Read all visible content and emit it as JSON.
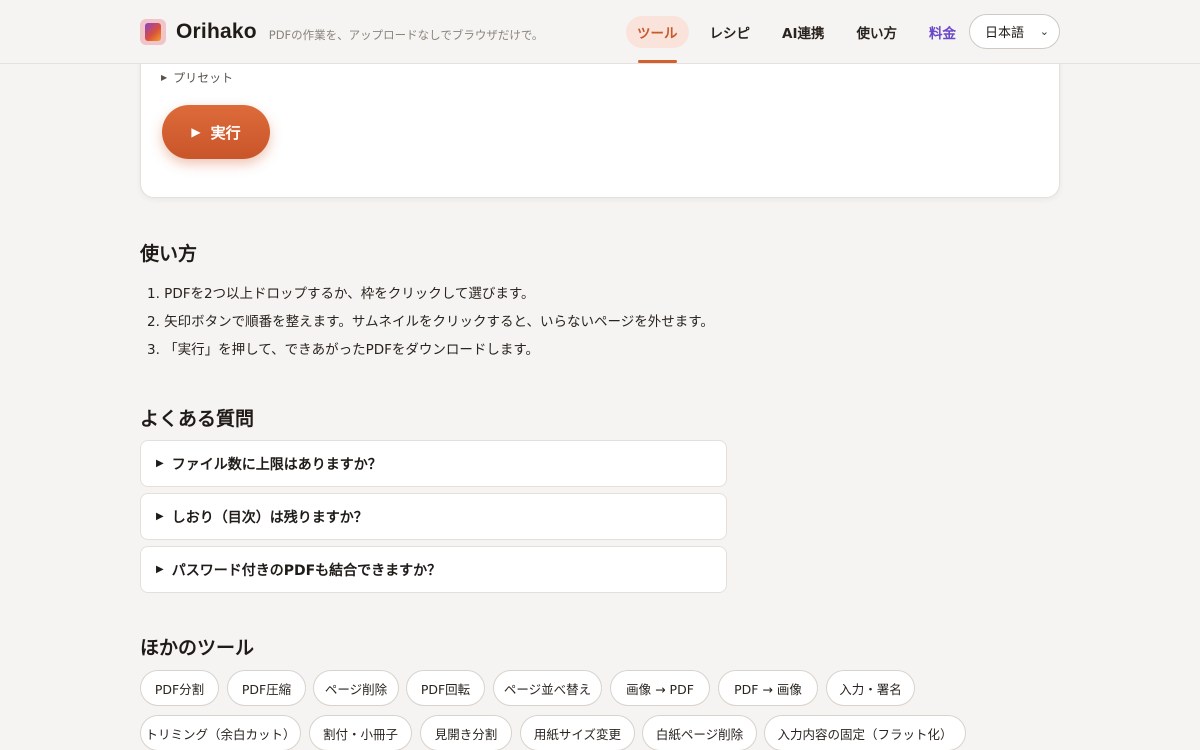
{
  "header": {
    "brand": "Orihako",
    "tagline": "PDFの作業を、アップロードなしでブラウザだけで。",
    "nav": [
      {
        "label": "ツール",
        "active": true
      },
      {
        "label": "レシピ"
      },
      {
        "label": "AI連携"
      },
      {
        "label": "使い方"
      },
      {
        "label": "料金",
        "accent": "#6b47c9"
      }
    ],
    "language": "日本語"
  },
  "tool": {
    "presets_label": "プリセット",
    "run_label": "実行"
  },
  "howto": {
    "title": "使い方",
    "steps": [
      "1. PDFを2つ以上ドロップするか、枠をクリックして選びます。",
      "2. 矢印ボタンで順番を整えます。サムネイルをクリックすると、いらないページを外せます。",
      "3. 「実行」を押して、できあがったPDFをダウンロードします。"
    ]
  },
  "faq": {
    "title": "よくある質問",
    "items": [
      "ファイル数に上限はありますか？",
      "しおり（目次）は残りますか？",
      "パスワード付きのPDFも結合できますか？"
    ]
  },
  "other_tools": {
    "title": "ほかのツール",
    "row1": [
      "PDF分割",
      "PDF圧縮",
      "ページ削除",
      "PDF回転",
      "ページ並べ替え",
      "画像 → PDF",
      "PDF → 画像",
      "入力・署名"
    ],
    "row2": [
      "トリミング（余白カット）",
      "割付・小冊子",
      "見開き分割",
      "用紙サイズ変更",
      "白紙ページ削除",
      "入力内容の固定（フラット化）"
    ]
  },
  "colors": {
    "accent": "#d06030",
    "pricing": "#6b47c9",
    "background": "#f6f4f2"
  }
}
